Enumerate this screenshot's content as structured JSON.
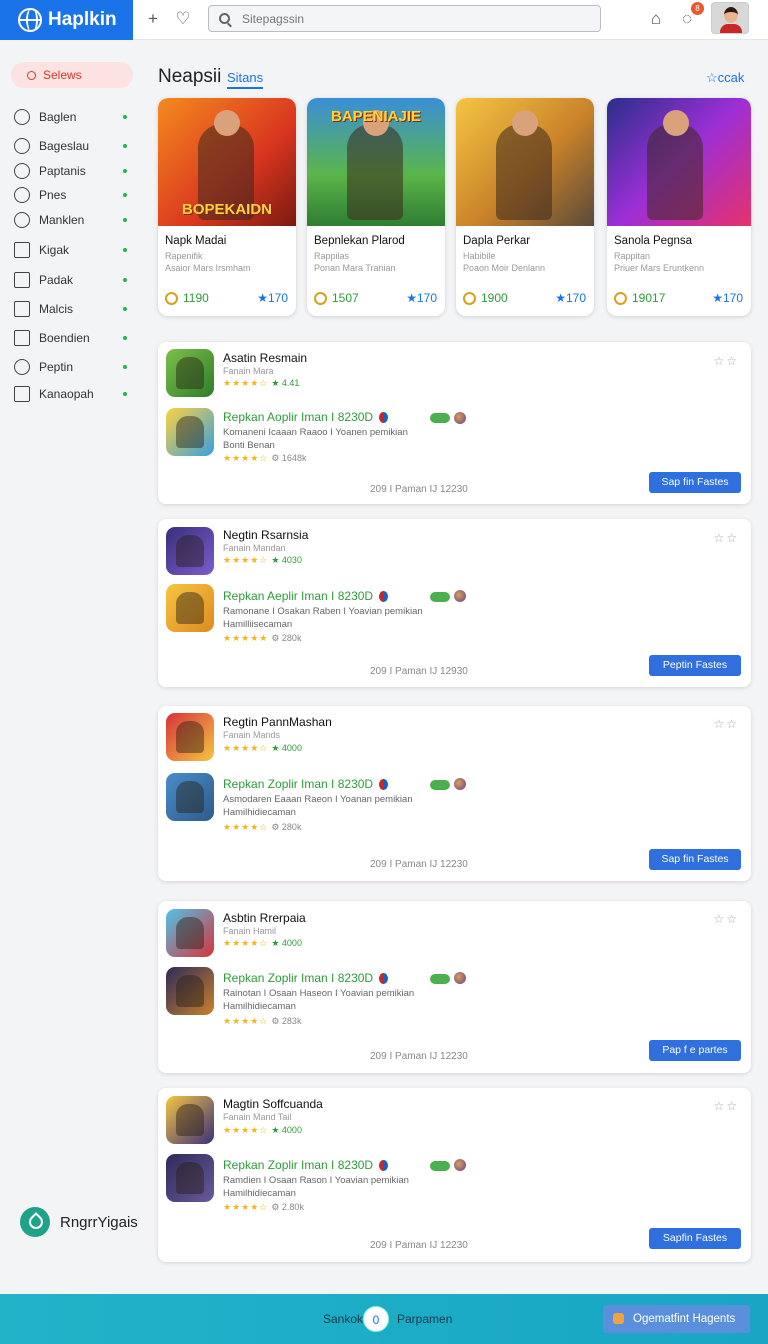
{
  "header": {
    "logo": "Haplkin",
    "search_placeholder": "Sitepagssin",
    "notification_count": "8"
  },
  "sidebar": {
    "active": "Selews",
    "items": [
      "Baglen",
      "Bageslau",
      "Paptanis",
      "Pnes",
      "Manklen",
      "Kigak",
      "Padak",
      "Malcis",
      "Boendien",
      "Peptin",
      "Kanaopah"
    ],
    "footer": "RngrrYigais"
  },
  "main": {
    "title": "Neapsii",
    "tab": "Sitans",
    "link": "ccak"
  },
  "featured": [
    {
      "banner": "BOPEKAIDN",
      "name": "Napk Madai",
      "sub1": "Rapenifik",
      "sub2": "Asaior Mars Irsmham",
      "price": "1190",
      "rating": "170",
      "bg": "linear-gradient(135deg,#f58a1f,#d9361f 60%,#7a1a10)"
    },
    {
      "banner": "BAPENIAJIE",
      "name": "Bepnlekan Plarod",
      "sub1": "Rappilas",
      "sub2": "Ponan Mara Tranian",
      "price": "1507",
      "rating": "170",
      "bg": "linear-gradient(180deg,#3a8fd6,#5bb54a 60%,#2e7d32)"
    },
    {
      "banner": "",
      "name": "Dapla Perkar",
      "sub1": "Habibile",
      "sub2": "Poaon Moir Denlann",
      "price": "1900",
      "rating": "170",
      "bg": "linear-gradient(135deg,#f5c542,#c9822a 55%,#5a4a3a)"
    },
    {
      "banner": "",
      "name": "Sanola Pegnsa",
      "sub1": "Rappitan",
      "sub2": "Priuer Mars Eruntkenn",
      "price": "19017",
      "rating": "170",
      "bg": "linear-gradient(135deg,#2a2f8a,#9c2fd6 50%,#e8306a)"
    }
  ],
  "groups": [
    {
      "title": "Asatin Resmain",
      "sub": "Fanain Mara",
      "score": "4.41",
      "release_title": "Repkan Aoplir Iman I 8230D",
      "desc1": "Komaneni Icaaan Raaoo I Yoanen pemikian",
      "desc2": "Bonti Benan",
      "count": "1648k",
      "footer": "209 I Paman IJ 12230",
      "button": "Sap fin Fastes",
      "icon1": "linear-gradient(135deg,#7cc04a,#2f7d2b)",
      "icon2": "linear-gradient(135deg,#ffd23f,#37a0e0)"
    },
    {
      "title": "Negtin Rsarnsia",
      "sub": "Fanain Mandan",
      "score": "4030",
      "release_title": "Repkan Aeplir Iman I 8230D",
      "desc1": "Ramonane I Osakan Raben I Yoavian pemikian",
      "desc2": "Hamilliisecaman",
      "count": "280k",
      "footer": "209 I Paman IJ 12930",
      "button": "Peptin Fastes",
      "icon1": "linear-gradient(135deg,#3a2f7a,#7a5cd0)",
      "icon2": "linear-gradient(135deg,#f5c542,#e08a1f)"
    },
    {
      "title": "Regtin PannMashan",
      "sub": "Fanain Mands",
      "score": "4000",
      "release_title": "Repkan Zoplir Iman I 8230D",
      "desc1": "Asmodaren Eaaan Raeon I Yoanan pemikian",
      "desc2": "Hamilhidiecaman",
      "count": "280k",
      "footer": "209 I Paman IJ 12230",
      "button": "Sap fin Fastes",
      "icon1": "linear-gradient(135deg,#d8333a,#f5c542)",
      "icon2": "linear-gradient(135deg,#4a8ccc,#2e5b8a)"
    },
    {
      "title": "Asbtin Rrerpaia",
      "sub": "Fanain Hamil",
      "score": "4000",
      "release_title": "Repkan Zoplir Iman I 8230D",
      "desc1": "Rainotan I Osaan Haseon I Yoavian pemikian",
      "desc2": "Hamilhidiecaman",
      "count": "283k",
      "footer": "209 I Paman IJ 12230",
      "button": "Pap f e partes",
      "icon1": "linear-gradient(135deg,#4fc3e8,#d8333a)",
      "icon2": "linear-gradient(135deg,#2e2a5a,#c9822a)"
    },
    {
      "title": "Magtin Soffcuanda",
      "sub": "Fanain Mand Tail",
      "score": "4000",
      "release_title": "Repkan Zoplir Iman I 8230D",
      "desc1": "Ramdien I Osaan Rason I Yoavian pemikian",
      "desc2": "Hamilhidiecaman",
      "count": "2.80k",
      "footer": "209 I Paman IJ 12230",
      "button": "Sapfin Fastes",
      "icon1": "linear-gradient(135deg,#f5c542,#3a2f7a)",
      "icon2": "linear-gradient(135deg,#2e2a5a,#6a5a9a)"
    }
  ],
  "bottom": {
    "left": "Sankok",
    "counter": "0",
    "right": "Parpamen",
    "button": "Ogematfint Hagents"
  },
  "colors": {
    "brand": "#1a73e8",
    "active": "#d9362b",
    "price": "#2e9b3a",
    "button": "#2f6fde",
    "bottom_bar": "#22b3c9"
  }
}
